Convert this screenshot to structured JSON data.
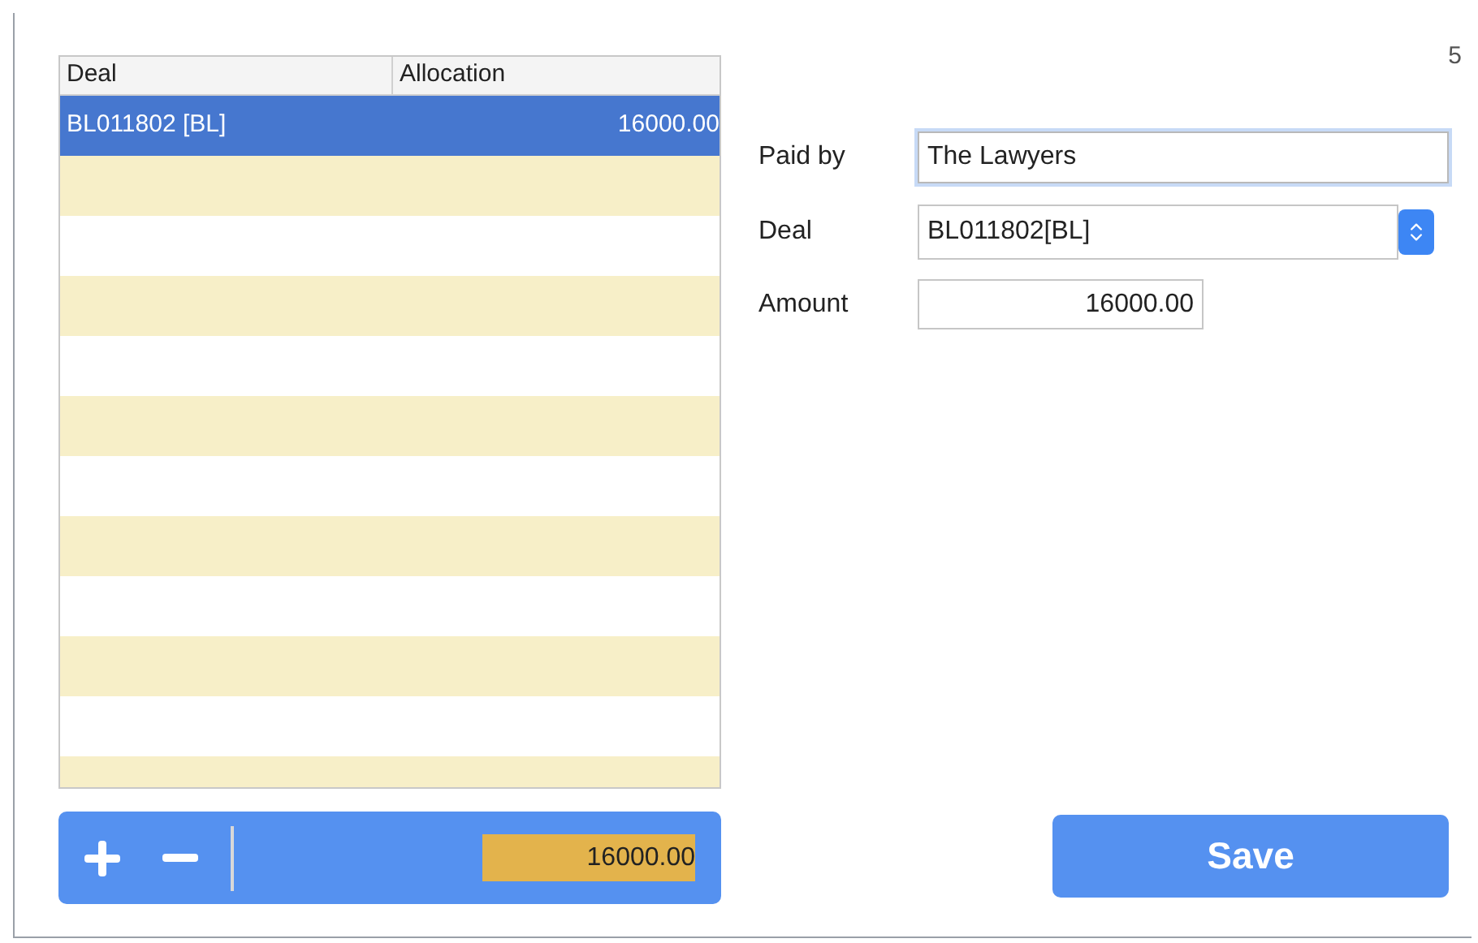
{
  "page_number": "5",
  "table": {
    "columns": [
      "Deal",
      "Allocation"
    ],
    "rows": [
      {
        "deal": "BL011802 [BL]",
        "allocation": "16000.00",
        "selected": true
      }
    ]
  },
  "toolbar": {
    "total": "16000.00"
  },
  "form": {
    "paid_by": {
      "label": "Paid by",
      "value": "The Lawyers"
    },
    "deal": {
      "label": "Deal",
      "value": "BL011802[BL]"
    },
    "amount": {
      "label": "Amount",
      "value": "16000.00"
    }
  },
  "save_button": "Save"
}
